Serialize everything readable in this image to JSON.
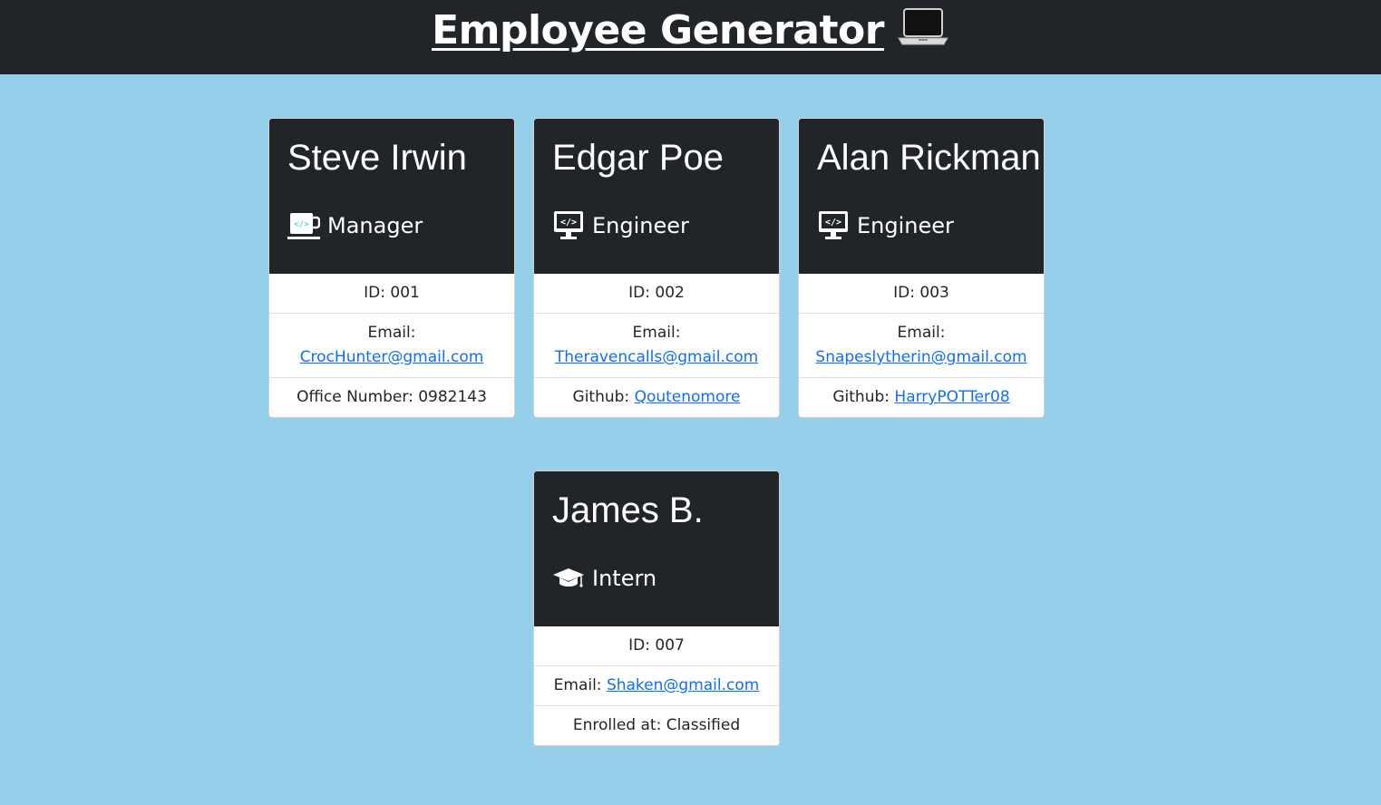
{
  "header": {
    "title": "Employee Generator",
    "icon": "laptop-icon"
  },
  "employees": [
    {
      "name": "Steve Irwin",
      "role": "Manager",
      "role_icon": "coffee-cup-icon",
      "id_text": "ID: 001",
      "email_label": "Email:",
      "email": "CrocHunter@gmail.com",
      "extra_label": "Office Number: 0982143",
      "extra_link": ""
    },
    {
      "name": "Edgar Poe",
      "role": "Engineer",
      "role_icon": "code-monitor-icon",
      "id_text": "ID: 002",
      "email_label": "Email:",
      "email": "Theravencalls@gmail.com",
      "extra_label": "Github:",
      "extra_link": "Qoutenomore"
    },
    {
      "name": "Alan Rickman",
      "role": "Engineer",
      "role_icon": "code-monitor-icon",
      "id_text": "ID: 003",
      "email_label": "Email:",
      "email": "Snapeslytherin@gmail.com",
      "extra_label": "Github:",
      "extra_link": "HarryPOTTer08"
    },
    {
      "name": "James B.",
      "role": "Intern",
      "role_icon": "graduation-cap-icon",
      "id_text": "ID: 007",
      "email_label": "Email:",
      "email": "Shaken@gmail.com",
      "extra_label": "Enrolled at: Classified",
      "extra_link": ""
    }
  ],
  "colors": {
    "page_background": "#96cfe9",
    "header_background": "#212529",
    "card_header": "#212529",
    "link": "#0d6efd"
  }
}
